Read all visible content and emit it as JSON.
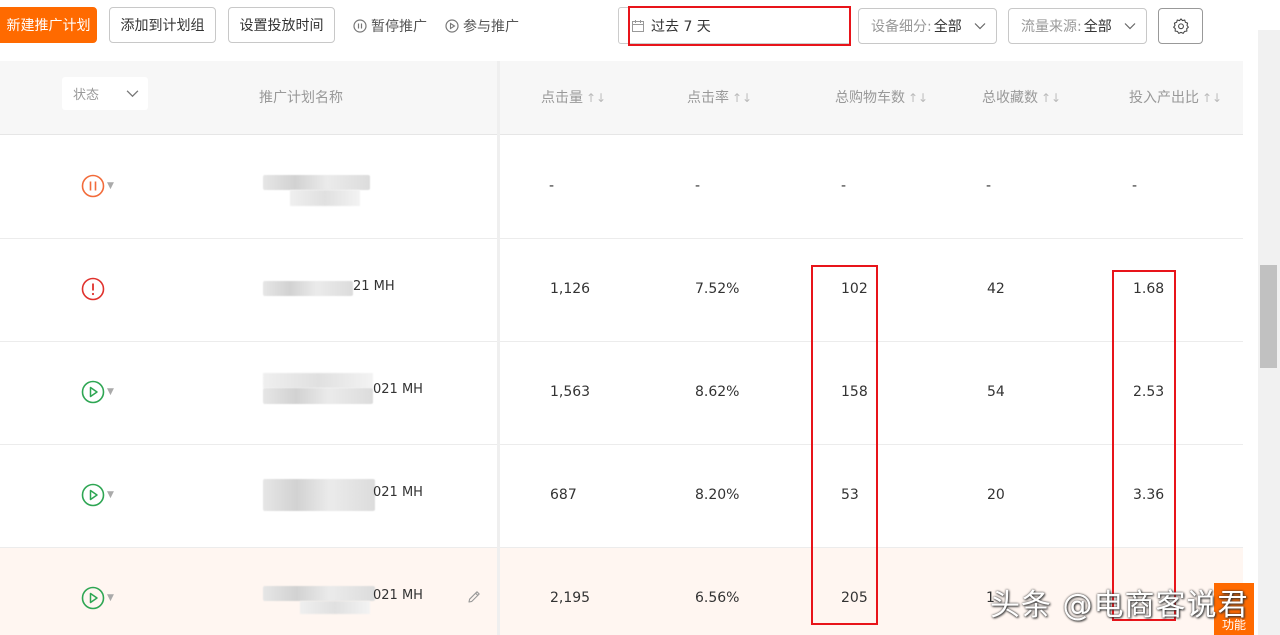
{
  "toolbar": {
    "new_plan_label": "新建推广计划",
    "add_to_group_label": "添加到计划组",
    "set_time_label": "设置投放时间",
    "pause_label": "暂停推广",
    "join_label": "参与推广",
    "date_range_value": "过去 7 天",
    "device_label": "设备细分:",
    "device_value": "全部",
    "traffic_label": "流量来源:",
    "traffic_value": "全部"
  },
  "table": {
    "status_filter_label": "状态",
    "columns": {
      "name": "推广计划名称",
      "clicks": "点击量",
      "ctr": "点击率",
      "cart_adds": "总购物车数",
      "favorites": "总收藏数",
      "roi": "投入产出比"
    },
    "sort_glyph": "↑↓",
    "rows": [
      {
        "status": "paused",
        "name_suffix": "",
        "clicks": "-",
        "ctr": "-",
        "cart_adds": "-",
        "favorites": "-",
        "roi": "-"
      },
      {
        "status": "warning",
        "name_suffix": "21 MH",
        "clicks": "1,126",
        "ctr": "7.52%",
        "cart_adds": "102",
        "favorites": "42",
        "roi": "1.68"
      },
      {
        "status": "running",
        "name_suffix": "021 MH",
        "clicks": "1,563",
        "ctr": "8.62%",
        "cart_adds": "158",
        "favorites": "54",
        "roi": "2.53"
      },
      {
        "status": "running",
        "name_suffix": "021 MH",
        "clicks": "687",
        "ctr": "8.20%",
        "cart_adds": "53",
        "favorites": "20",
        "roi": "3.36"
      },
      {
        "status": "running",
        "name_suffix": "021 MH",
        "clicks": "2,195",
        "ctr": "6.56%",
        "cart_adds": "205",
        "favorites": "1",
        "roi": ""
      }
    ]
  },
  "side_widget_label": "功能",
  "watermark": "头条 @电商客说君",
  "colors": {
    "accent": "#ff6a00",
    "highlight_box": "#e8141a",
    "paused": "#f26b3a",
    "warning": "#e0312c",
    "running": "#2ea653"
  }
}
